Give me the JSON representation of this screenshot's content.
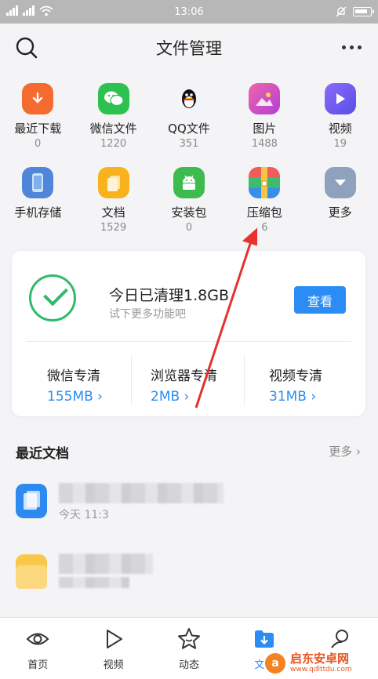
{
  "status_bar": {
    "time": "13:06"
  },
  "header": {
    "title": "文件管理"
  },
  "grid_row1": [
    {
      "label": "最近下载",
      "count": "0",
      "icon": "download-icon",
      "color": "#f46a2f"
    },
    {
      "label": "微信文件",
      "count": "1220",
      "icon": "wechat-icon",
      "color": "#2dc14f"
    },
    {
      "label": "QQ文件",
      "count": "351",
      "icon": "qq-penguin-icon",
      "color": "#f2f4f7"
    },
    {
      "label": "图片",
      "count": "1488",
      "icon": "image-icon",
      "color": "#e54a95"
    },
    {
      "label": "视频",
      "count": "19",
      "icon": "video-play-icon",
      "color": "#6c5cf0"
    }
  ],
  "grid_row2": [
    {
      "label": "手机存储",
      "count": "",
      "icon": "phone-storage-icon",
      "color": "#4f86d8"
    },
    {
      "label": "文档",
      "count": "1529",
      "icon": "document-icon",
      "color": "#f7b21d"
    },
    {
      "label": "安装包",
      "count": "0",
      "icon": "android-icon",
      "color": "#3dbb4e"
    },
    {
      "label": "压缩包",
      "count": "6",
      "icon": "archive-icon",
      "color": "#3bb4e8"
    },
    {
      "label": "更多",
      "count": "",
      "icon": "chevron-down-icon",
      "color": "#8ea2bd"
    }
  ],
  "clean_card": {
    "main_text": "今日已清理1.8GB",
    "sub_text": "试下更多功能吧",
    "view_label": "查看",
    "stats": [
      {
        "label": "微信专清",
        "value": "155MB"
      },
      {
        "label": "浏览器专清",
        "value": "2MB"
      },
      {
        "label": "视频专清",
        "value": "31MB"
      }
    ]
  },
  "recent": {
    "title": "最近文档",
    "more_label": "更多",
    "docs": [
      {
        "time": "今天 11:3",
        "icon": "doc-file-icon"
      },
      {
        "time": "",
        "icon": "folder-file-icon"
      }
    ]
  },
  "bottom_nav": [
    {
      "label": "首页",
      "icon": "eye-icon"
    },
    {
      "label": "视频",
      "icon": "play-icon"
    },
    {
      "label": "动态",
      "icon": "star-icon"
    },
    {
      "label": "文件",
      "icon": "file-download-icon"
    },
    {
      "label": "",
      "icon": "search-person-icon"
    }
  ],
  "watermark": {
    "name": "启东安卓网",
    "url": "www.qdlttdu.com"
  },
  "colors": {
    "accent": "#2b8cf3",
    "success": "#2fba6e",
    "arrow": "#e5322d"
  }
}
